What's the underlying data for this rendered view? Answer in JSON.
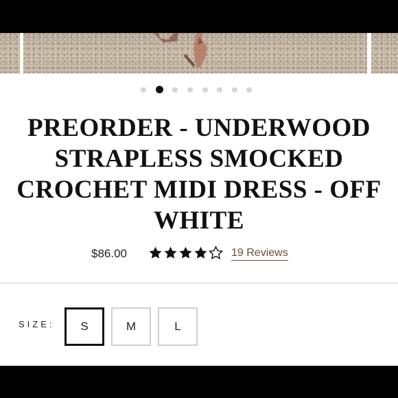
{
  "carousel": {
    "slide_count": 8,
    "active_index": 1
  },
  "product": {
    "title": "PREORDER - UNDERWOOD STRAPLESS SMOCKED CROCHET MIDI DRESS - OFF WHITE",
    "price": "$86.00",
    "rating": 4,
    "rating_max": 5,
    "reviews_label": "19 Reviews"
  },
  "size_selector": {
    "label": "SIZE:",
    "options": [
      "S",
      "M",
      "L"
    ],
    "selected": "S"
  },
  "colors": {
    "text": "#111111",
    "reviews_link": "#6b4a3a",
    "border": "#cfcfcf",
    "dot_inactive": "#d6d6d6"
  }
}
